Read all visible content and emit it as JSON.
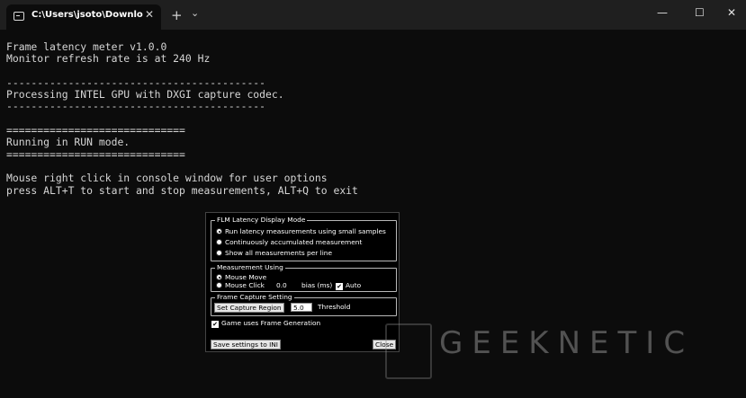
{
  "tab": {
    "title": "C:\\Users\\jsoto\\Downloads\\fln",
    "close": "✕"
  },
  "titlebar": {
    "new_tab": "+",
    "dropdown": "⌄",
    "minimize": "—",
    "maximize": "☐",
    "close": "✕"
  },
  "console_lines": [
    "Frame latency meter v1.0.0",
    "Monitor refresh rate is at 240 Hz",
    "",
    "------------------------------------------",
    "Processing INTEL GPU with DXGI capture codec.",
    "------------------------------------------",
    "",
    "=============================",
    "Running in RUN mode.",
    "=============================",
    "",
    "Mouse right click in console window for user options",
    "press ALT+T to start and stop measurements, ALT+Q to exit"
  ],
  "dialog": {
    "display_mode": {
      "legend": "FLM Latency Display Mode",
      "options": [
        {
          "label": "Run latency measurements using small samples",
          "selected": true
        },
        {
          "label": "Continuously accumulated measurement",
          "selected": false
        },
        {
          "label": "Show all measurements per line",
          "selected": false
        }
      ]
    },
    "measurement": {
      "legend": "Measurement Using",
      "mouse_move": "Mouse Move",
      "mouse_click": "Mouse Click",
      "bias_value": "0.0",
      "bias_label": "bias (ms)",
      "auto_label": "Auto",
      "auto_check": "✔"
    },
    "capture": {
      "legend": "Frame Capture Setting",
      "set_region": "Set Capture Region",
      "threshold_value": "5.0",
      "threshold_label": "Threshold"
    },
    "frame_gen": {
      "label": "Game uses Frame Generation",
      "check": "✔"
    },
    "save_button": "Save settings to INI",
    "close_button": "Close"
  },
  "watermark": {
    "text": "GEEKNETIC"
  }
}
